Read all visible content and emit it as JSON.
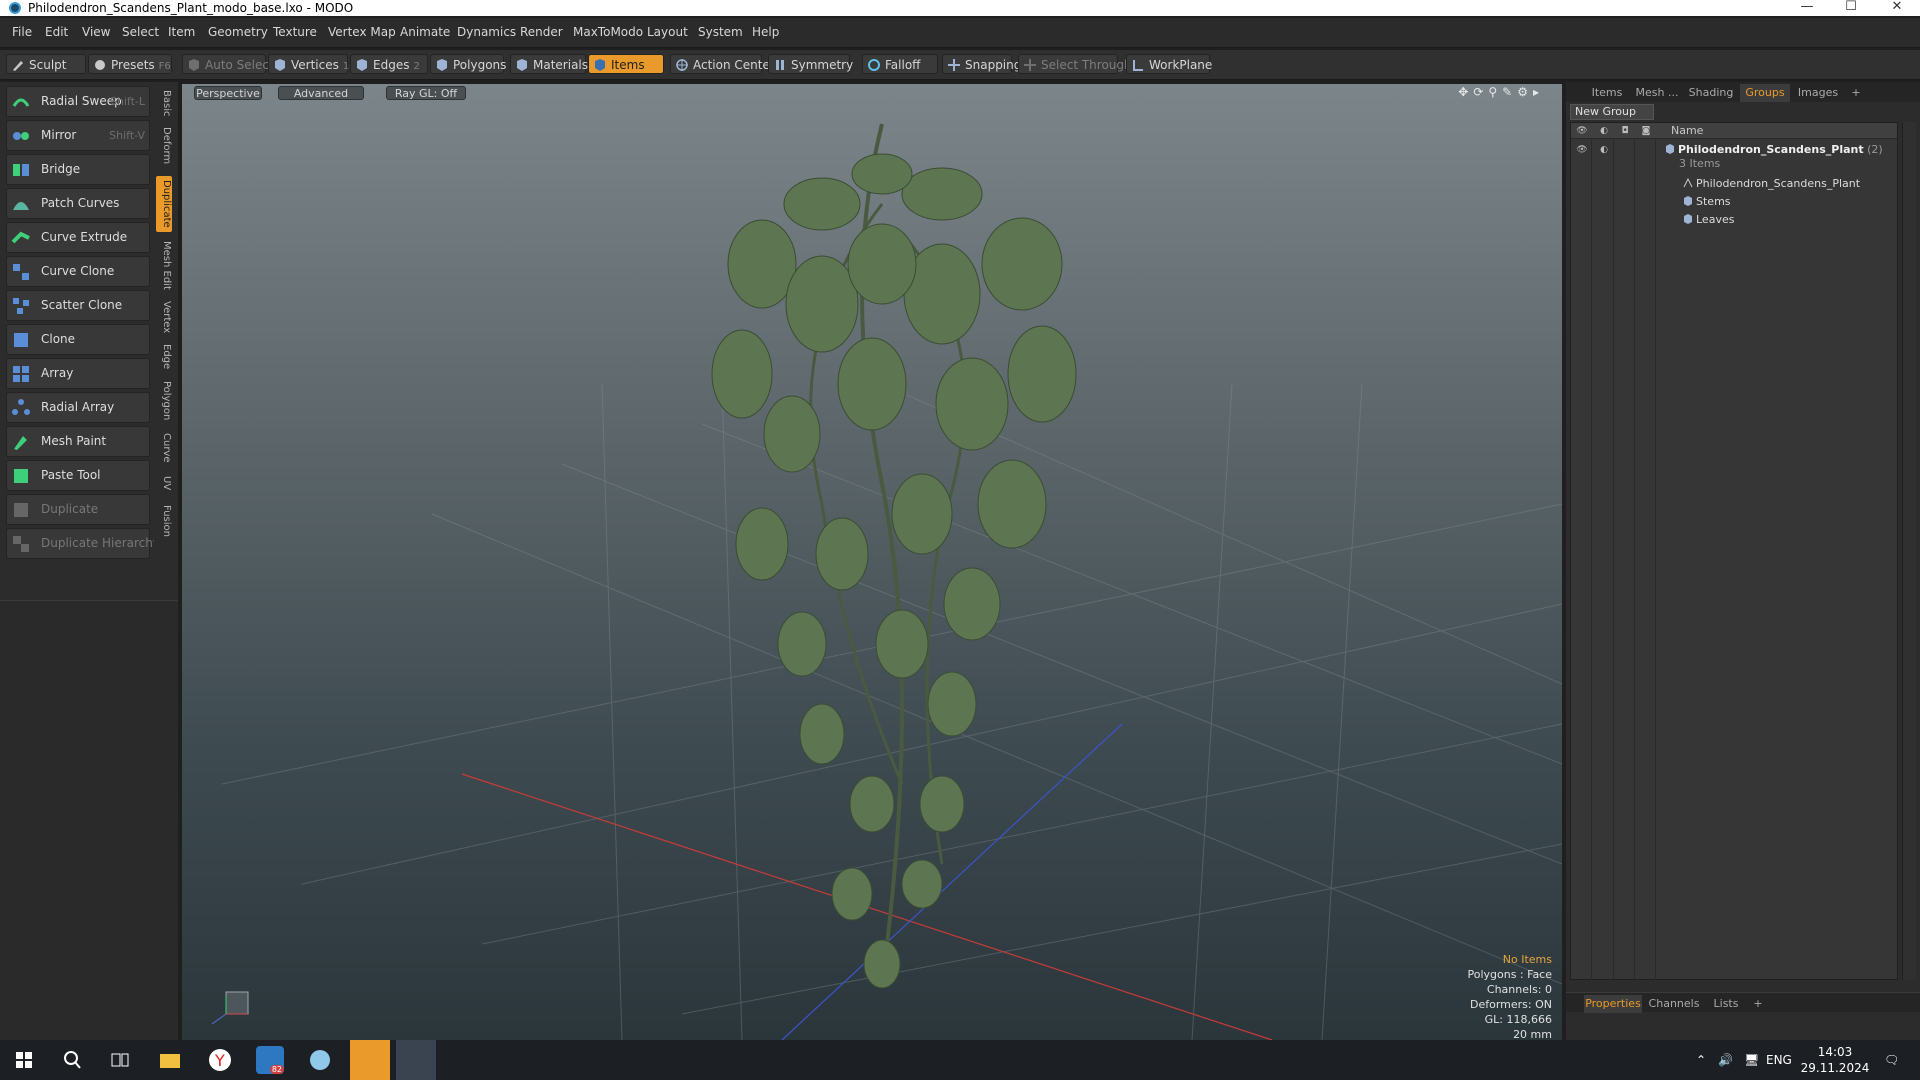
{
  "window": {
    "title": "Philodendron_Scandens_Plant_modo_base.lxo - MODO",
    "minimize": "—",
    "maximize": "☐",
    "close": "✕"
  },
  "menu": [
    "File",
    "Edit",
    "View",
    "Select",
    "Item",
    "Geometry",
    "Texture",
    "Vertex Map",
    "Animate",
    "Dynamics",
    "Render",
    "MaxToModo",
    "Layout",
    "System",
    "Help"
  ],
  "toolbar": {
    "sculpt": "Sculpt",
    "presets": "Presets",
    "presets_hotkey": "F6",
    "auto_select": "Auto Select",
    "vertices": "Vertices",
    "vertices_hotkey": "1",
    "edges": "Edges",
    "edges_hotkey": "2",
    "polygons": "Polygons",
    "materials": "Materials",
    "items": "Items",
    "action_center": "Action Center",
    "symmetry": "Symmetry",
    "falloff": "Falloff",
    "snapping": "Snapping",
    "select_through": "Select Through",
    "workplane": "WorkPlane"
  },
  "tools": [
    {
      "label": "Radial Sweep",
      "hotkey": "Shift-L",
      "enabled": true
    },
    {
      "label": "Mirror",
      "hotkey": "Shift-V",
      "enabled": true
    },
    {
      "label": "Bridge",
      "hotkey": "",
      "enabled": true
    },
    {
      "label": "Patch Curves",
      "hotkey": "",
      "enabled": true
    },
    {
      "label": "Curve Extrude",
      "hotkey": "",
      "enabled": true
    },
    {
      "label": "Curve Clone",
      "hotkey": "",
      "enabled": true
    },
    {
      "label": "Scatter Clone",
      "hotkey": "",
      "enabled": true
    },
    {
      "label": "Clone",
      "hotkey": "",
      "enabled": true
    },
    {
      "label": "Array",
      "hotkey": "",
      "enabled": true
    },
    {
      "label": "Radial Array",
      "hotkey": "",
      "enabled": true
    },
    {
      "label": "Mesh Paint",
      "hotkey": "",
      "enabled": true
    },
    {
      "label": "Paste Tool",
      "hotkey": "",
      "enabled": true
    },
    {
      "label": "Duplicate",
      "hotkey": "",
      "enabled": false
    },
    {
      "label": "Duplicate Hierarchy",
      "hotkey": "",
      "enabled": false
    }
  ],
  "vtabs": [
    "Basic",
    "Deform",
    "Duplicate",
    "Mesh Edit",
    "Vertex",
    "Edge",
    "Polygon",
    "Curve",
    "UV",
    "Fusion"
  ],
  "vtab_active": "Duplicate",
  "viewport": {
    "view": "Perspective",
    "shading": "Advanced",
    "raygl": "Ray GL: Off",
    "nav_icons": "✥⟳⚲✎⚙▸",
    "stats": [
      "No Items",
      "Polygons : Face",
      "Channels: 0",
      "Deformers: ON",
      "GL: 118,666",
      "20 mm"
    ]
  },
  "right_panel": {
    "tabs": [
      "Items",
      "Mesh ...",
      "Shading",
      "Groups",
      "Images",
      "+"
    ],
    "active_tab": "Groups",
    "new_group": "New Group",
    "header_name": "Name",
    "group_name": "Philodendron_Scandens_Plant",
    "group_count": "(2)",
    "group_items": "3 Items",
    "children": [
      "Philodendron_Scandens_Plant",
      "Stems",
      "Leaves"
    ],
    "bottom_tabs": [
      "Properties",
      "Channels",
      "Lists",
      "+"
    ],
    "bottom_active": "Properties"
  },
  "taskbar": {
    "lang": "ENG",
    "time": "14:03",
    "date": "29.11.2024",
    "badge": "82"
  },
  "colors": {
    "accent": "#e99a2a",
    "viewport_top": "#7c8589",
    "viewport_bottom": "#2b363b",
    "leaf": "#5d7550"
  }
}
